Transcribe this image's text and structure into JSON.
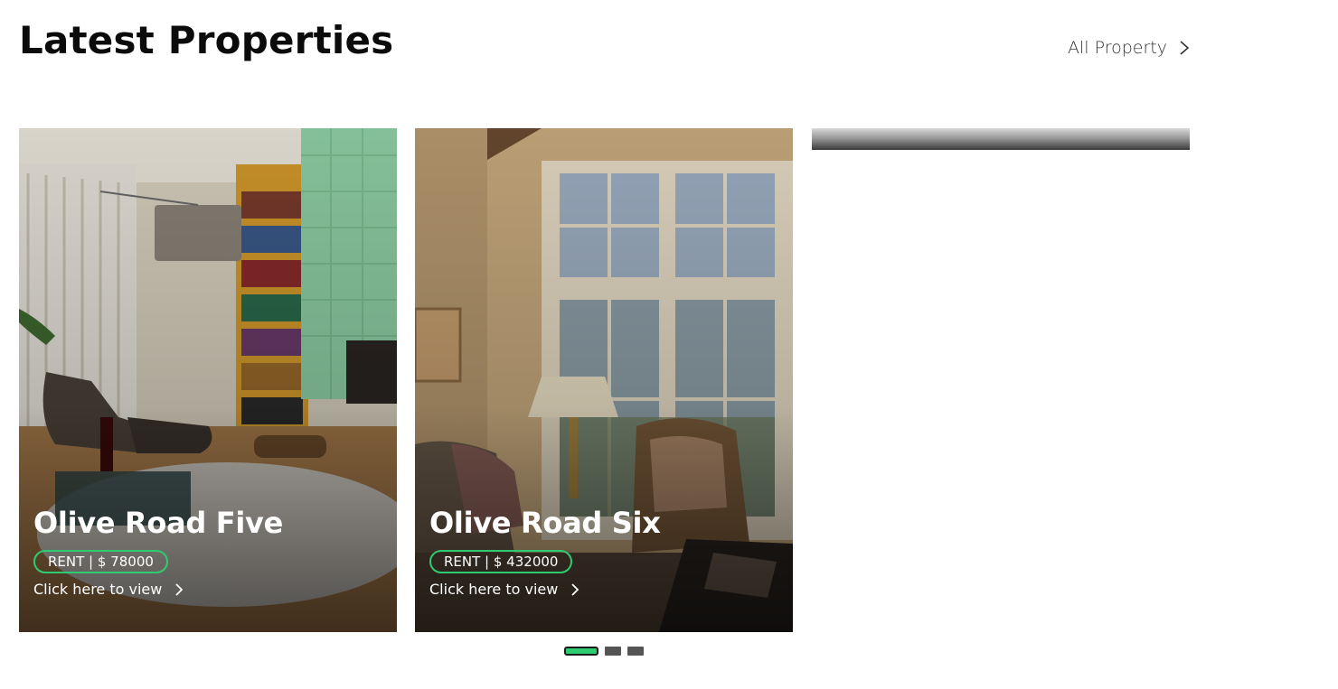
{
  "header": {
    "title": "Latest Properties",
    "all_link_label": "All Property",
    "all_link_icon": "chevron-right-icon"
  },
  "properties": [
    {
      "name": "Olive Road Five",
      "badge": "RENT | $ 78000",
      "cta": "Click here to view",
      "image": "living-room-bookshelf-photo"
    },
    {
      "name": "Olive Road Six",
      "badge": "RENT | $ 432000",
      "cta": "Click here to view",
      "image": "sitting-room-windows-photo"
    }
  ],
  "carousel": {
    "pages": 3,
    "active_page": 1
  },
  "colors": {
    "accent": "#2ecc71",
    "title": "#0b0b0b",
    "dot_inactive": "#555555"
  }
}
